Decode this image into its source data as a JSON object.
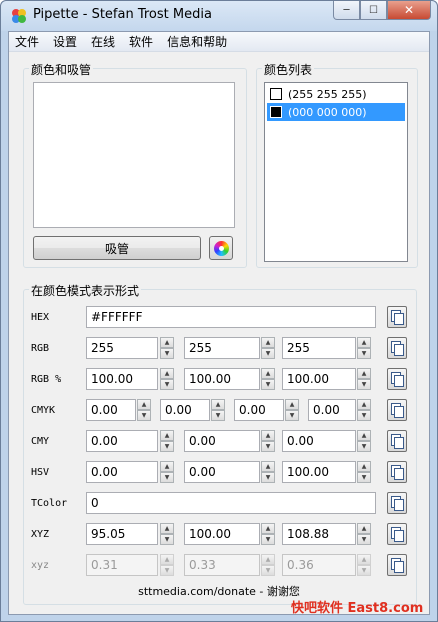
{
  "window": {
    "title": "Pipette - Stefan Trost Media",
    "minimize": "─",
    "maximize": "☐",
    "close": "✕"
  },
  "menu": [
    "文件",
    "设置",
    "在线",
    "软件",
    "信息和帮助"
  ],
  "picker": {
    "group_title": "颜色和吸管",
    "pick_button": "吸管"
  },
  "color_list": {
    "group_title": "颜色列表",
    "items": [
      {
        "label": "(255 255 255)",
        "swatch": "#ffffff",
        "selected": false
      },
      {
        "label": "(000 000 000)",
        "swatch": "#000000",
        "selected": true
      }
    ]
  },
  "formats": {
    "group_title": "在颜色模式表示形式",
    "hex": {
      "label": "HEX",
      "value": "#FFFFFF"
    },
    "rgb": {
      "label": "RGB",
      "values": [
        "255",
        "255",
        "255"
      ]
    },
    "rgb_pct": {
      "label": "RGB %",
      "values": [
        "100.00",
        "100.00",
        "100.00"
      ]
    },
    "cmyk": {
      "label": "CMYK",
      "values": [
        "0.00",
        "0.00",
        "0.00",
        "0.00"
      ]
    },
    "cmy": {
      "label": "CMY",
      "values": [
        "0.00",
        "0.00",
        "0.00"
      ]
    },
    "hsv": {
      "label": "HSV",
      "values": [
        "0.00",
        "0.00",
        "100.00"
      ]
    },
    "tcolor": {
      "label": "TColor",
      "value": "0"
    },
    "xyz": {
      "label": "XYZ",
      "values": [
        "95.05",
        "100.00",
        "108.88"
      ]
    },
    "xyz_small": {
      "label": "xyz",
      "values": [
        "0.31",
        "0.33",
        "0.36"
      ]
    }
  },
  "footer": "sttmedia.com/donate - 谢谢您",
  "watermark": "快吧软件 East8.com",
  "spin_up": "▲",
  "spin_down": "▼"
}
